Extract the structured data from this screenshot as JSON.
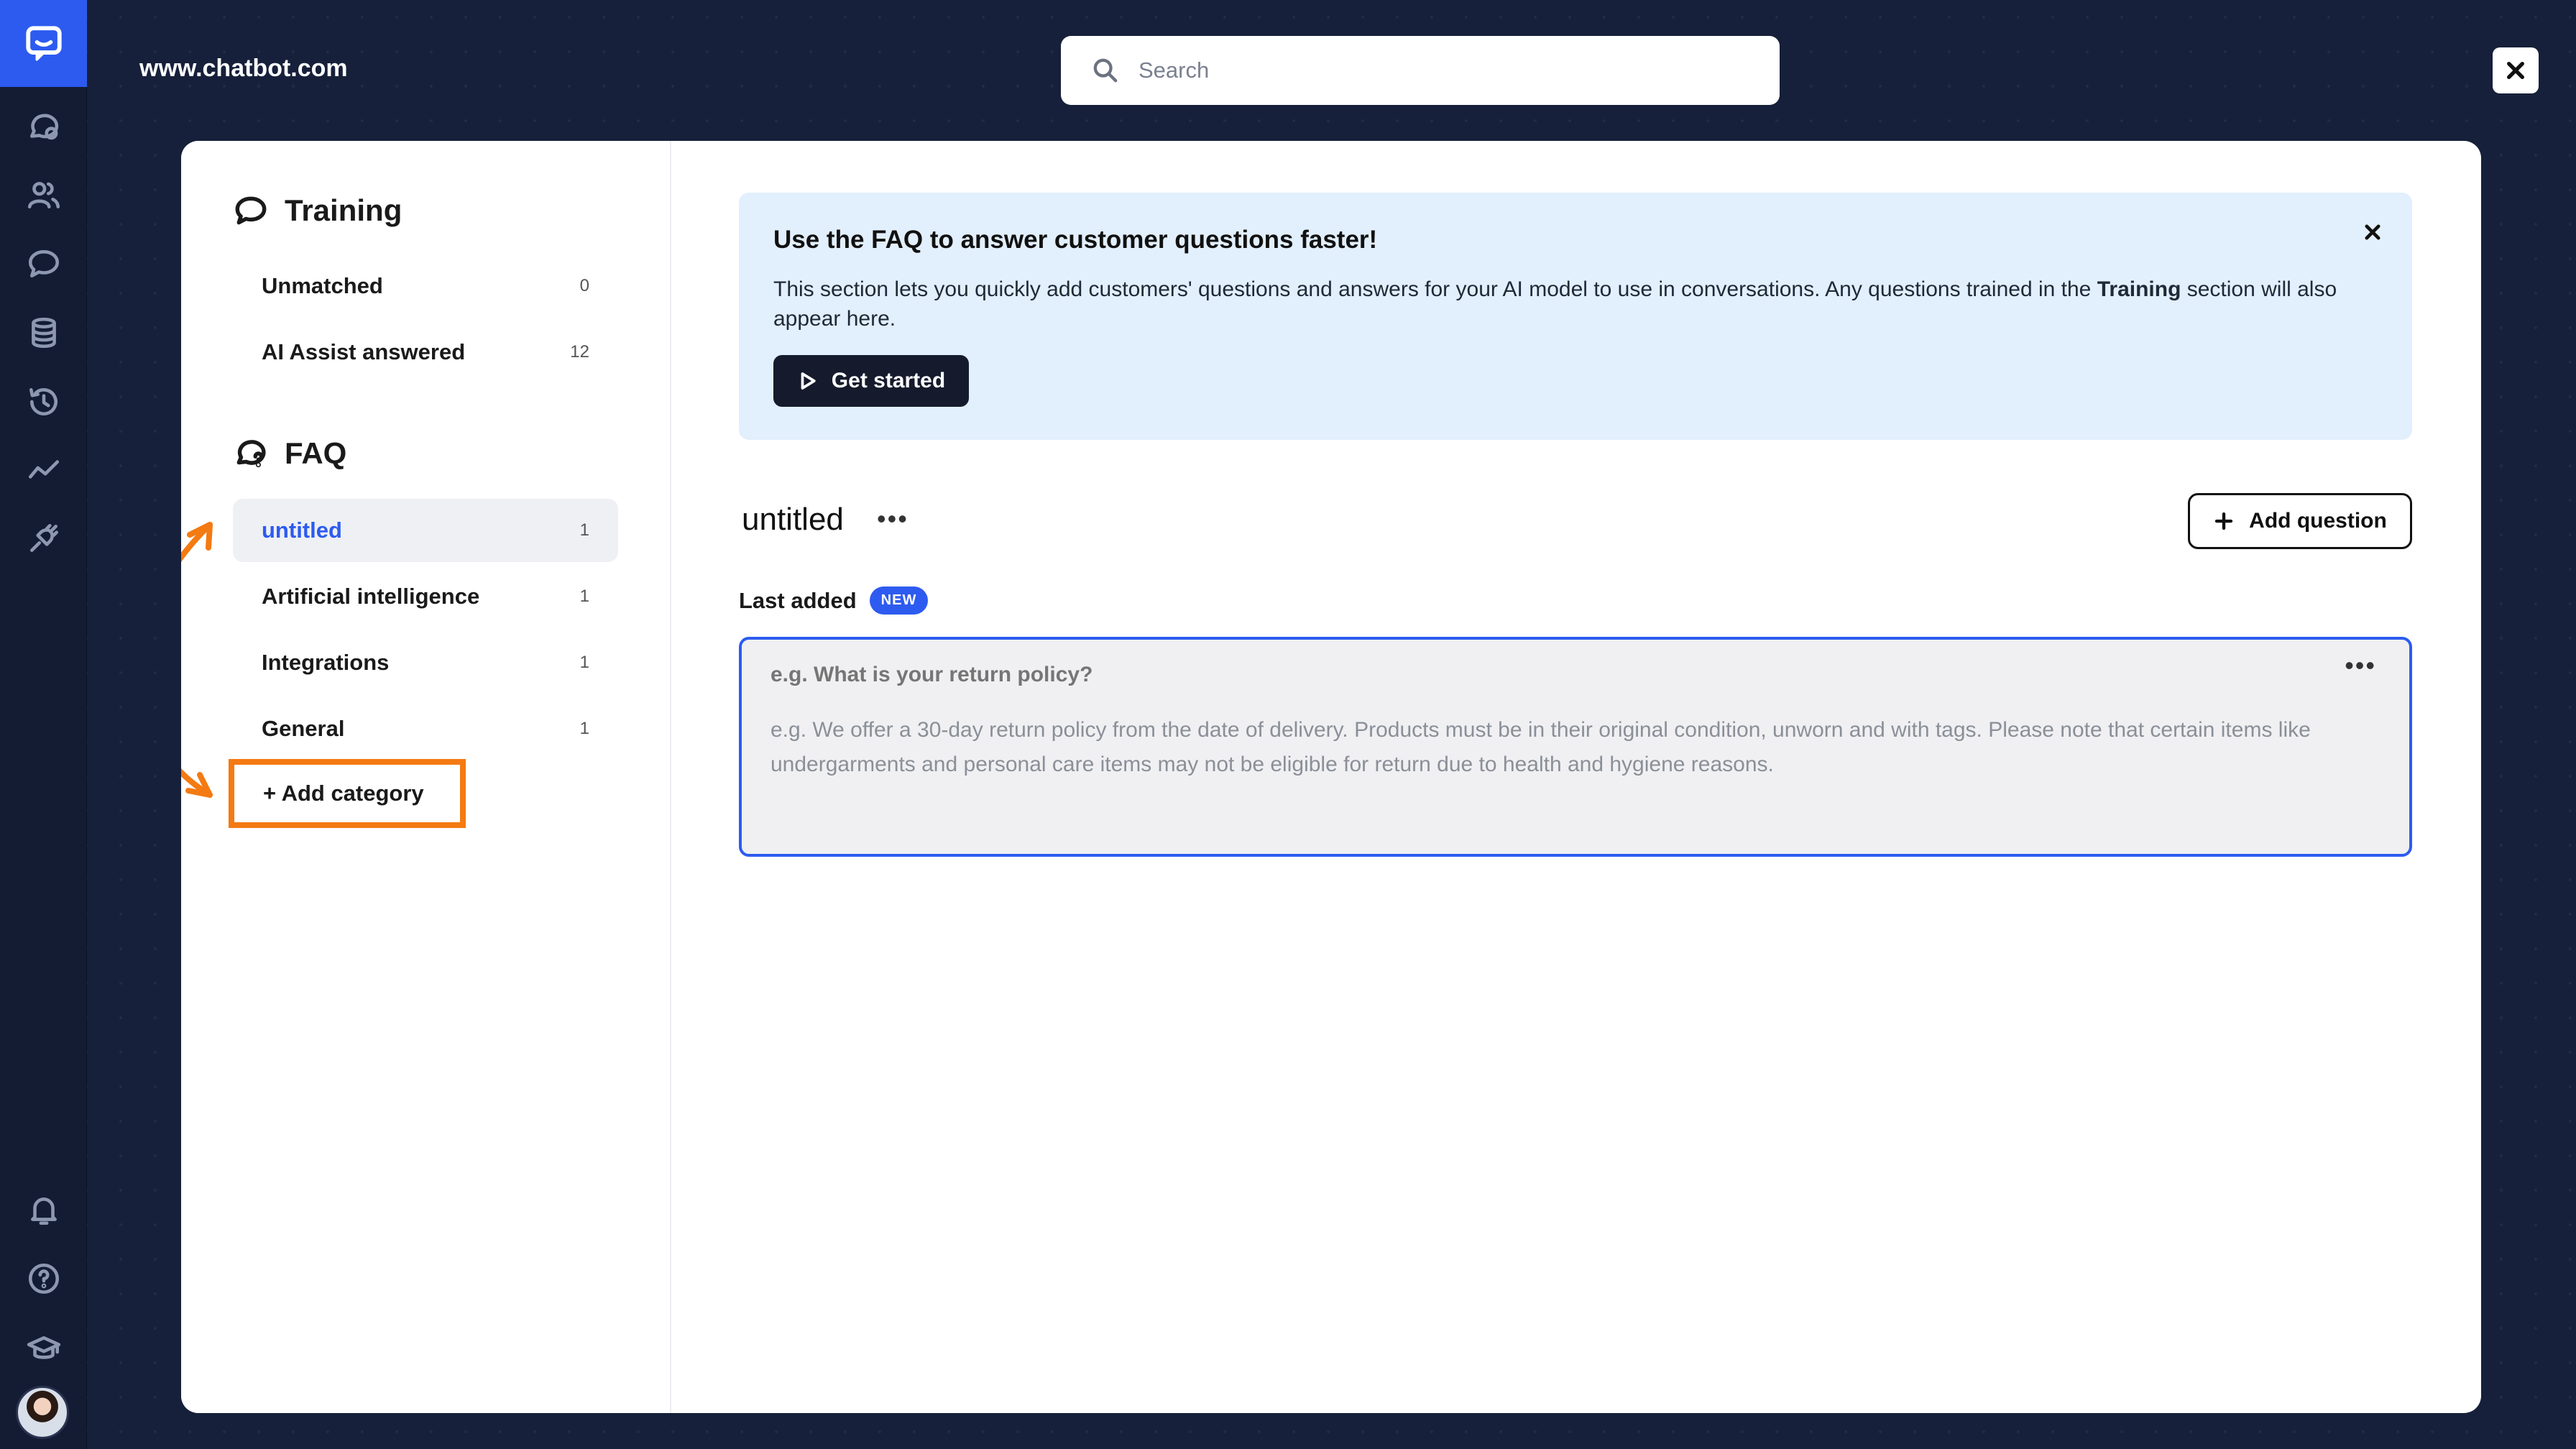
{
  "header": {
    "site": "www.chatbot.com",
    "search_placeholder": "Search"
  },
  "rail": {
    "icons": [
      "chat-bubble-icon",
      "users-icon",
      "messages-icon",
      "database-icon",
      "history-icon",
      "analytics-icon",
      "integrations-icon",
      "bell-icon",
      "help-icon",
      "academy-icon"
    ]
  },
  "training": {
    "title": "Training",
    "items": [
      {
        "label": "Unmatched",
        "count": "0"
      },
      {
        "label": "AI Assist answered",
        "count": "12"
      }
    ]
  },
  "faq": {
    "title": "FAQ",
    "items": [
      {
        "label": "untitled",
        "count": "1"
      },
      {
        "label": "Artificial intelligence",
        "count": "1"
      },
      {
        "label": "Integrations",
        "count": "1"
      },
      {
        "label": "General",
        "count": "1"
      }
    ],
    "add_category": "+ Add category"
  },
  "banner": {
    "title": "Use the FAQ to answer customer questions faster!",
    "text_before": "This section lets you quickly add customers' questions and answers for your AI model to use in conversations. Any questions trained in the ",
    "text_bold": "Training",
    "text_after": " section will also appear here.",
    "button": "Get started"
  },
  "category": {
    "title": "untitled",
    "add_question": "Add question",
    "last_added": "Last added",
    "badge": "NEW",
    "question_placeholder": "e.g. What is your return policy?",
    "answer_placeholder": "e.g. We offer a 30-day return policy from the date of delivery. Products must be in their original condition, unworn and with tags. Please note that certain items like undergarments and personal care items may not be eligible for return due to health and hygiene reasons."
  },
  "colors": {
    "accent": "#2d5bf0",
    "highlight": "#f47a12",
    "background": "#16203a",
    "banner": "#e2effc"
  }
}
